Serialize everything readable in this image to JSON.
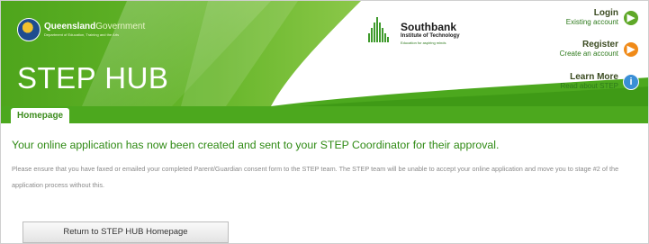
{
  "header": {
    "title": "STEP HUB",
    "qg_logo": {
      "name_bold": "Queensland",
      "name_light": "Government",
      "sub": "Department of Education, Training and the Arts"
    },
    "sb_logo": {
      "name": "Southbank",
      "institute": "Institute of Technology",
      "tagline": "Education for aspiring minds"
    },
    "actions": [
      {
        "label": "Login",
        "sub": "Existing account",
        "icon": "arrow-right-icon",
        "color": "#5fa828"
      },
      {
        "label": "Register",
        "sub": "Create an account",
        "icon": "arrow-right-icon",
        "color": "#f08a18"
      },
      {
        "label": "Learn More",
        "sub": "Read about STEP",
        "icon": "info-icon",
        "color": "#3a8fd6"
      }
    ]
  },
  "tabs": [
    {
      "label": "Homepage",
      "active": true
    }
  ],
  "content": {
    "headline": "Your online application has now been created and sent to your STEP Coordinator for their approval.",
    "body": "Please ensure that you have faxed or emailed your completed Parent/Guardian consent form to the STEP team. The STEP team will be unable to accept your online application and move you to stage #2 of the application process without this.",
    "button_label": "Return to STEP HUB Homepage"
  },
  "colors": {
    "brand_green": "#4ca81e",
    "headline_green": "#2f8a14",
    "body_gray": "#8a8a8a"
  }
}
